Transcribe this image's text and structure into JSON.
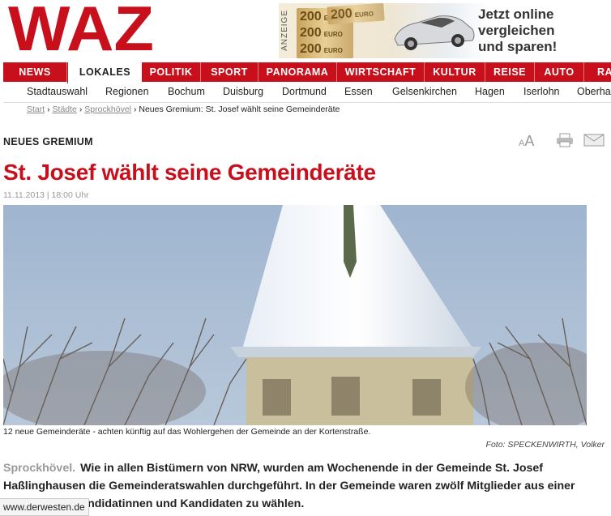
{
  "brand": {
    "logo_text": "WAZ",
    "color": "#c8101c"
  },
  "ad": {
    "label": "ANZEIGE",
    "note_value": "200",
    "note_currency": "EURO",
    "headline": "Jetzt online vergleichen und sparen!"
  },
  "nav": {
    "items": [
      "NEWS",
      "LOKALES",
      "POLITIK",
      "SPORT",
      "PANORAMA",
      "WIRTSCHAFT",
      "KULTUR",
      "REISE",
      "AUTO",
      "RA"
    ],
    "active": "LOKALES"
  },
  "subnav": {
    "items": [
      "Stadtauswahl",
      "Regionen",
      "Bochum",
      "Duisburg",
      "Dortmund",
      "Essen",
      "Gelsenkirchen",
      "Hagen",
      "Iserlohn",
      "Oberha"
    ]
  },
  "breadcrumb": {
    "start": "Start",
    "sep": "›",
    "staedte": "Städte",
    "town": "Sprockhövel",
    "current": "Neues Gremium: St. Josef wählt seine Gemeinderäte"
  },
  "article": {
    "kicker": "NEUES GREMIUM",
    "title": "St. Josef wählt seine Gemeinderäte",
    "date": "11.11.2013 | 18:00 Uhr",
    "caption": "12 neue Gemeinderäte - achten künftig auf das Wohlergehen der Gemeinde an der Kortenstraße.",
    "credit": "Foto: SPECKENWIRTH, Volker",
    "lead_place": "Sprockhövel.",
    "lead_text": "Wie in allen Bistümern von NRW, wurden am Wochenende in der Gemeinde St. Josef Haßlinghausen die Gemeinderatswahlen durchgeführt. In der Gemeinde waren zwölf Mitglieder aus einer Liste von 18 Kandidatinnen und Kandidaten zu wählen."
  },
  "tools": {
    "font_size_icon": "text-size-icon",
    "print_icon": "printer-icon",
    "mail_icon": "envelope-icon",
    "small_a": "A",
    "large_a": "A"
  },
  "status_bar": {
    "url": "www.derwesten.de"
  }
}
